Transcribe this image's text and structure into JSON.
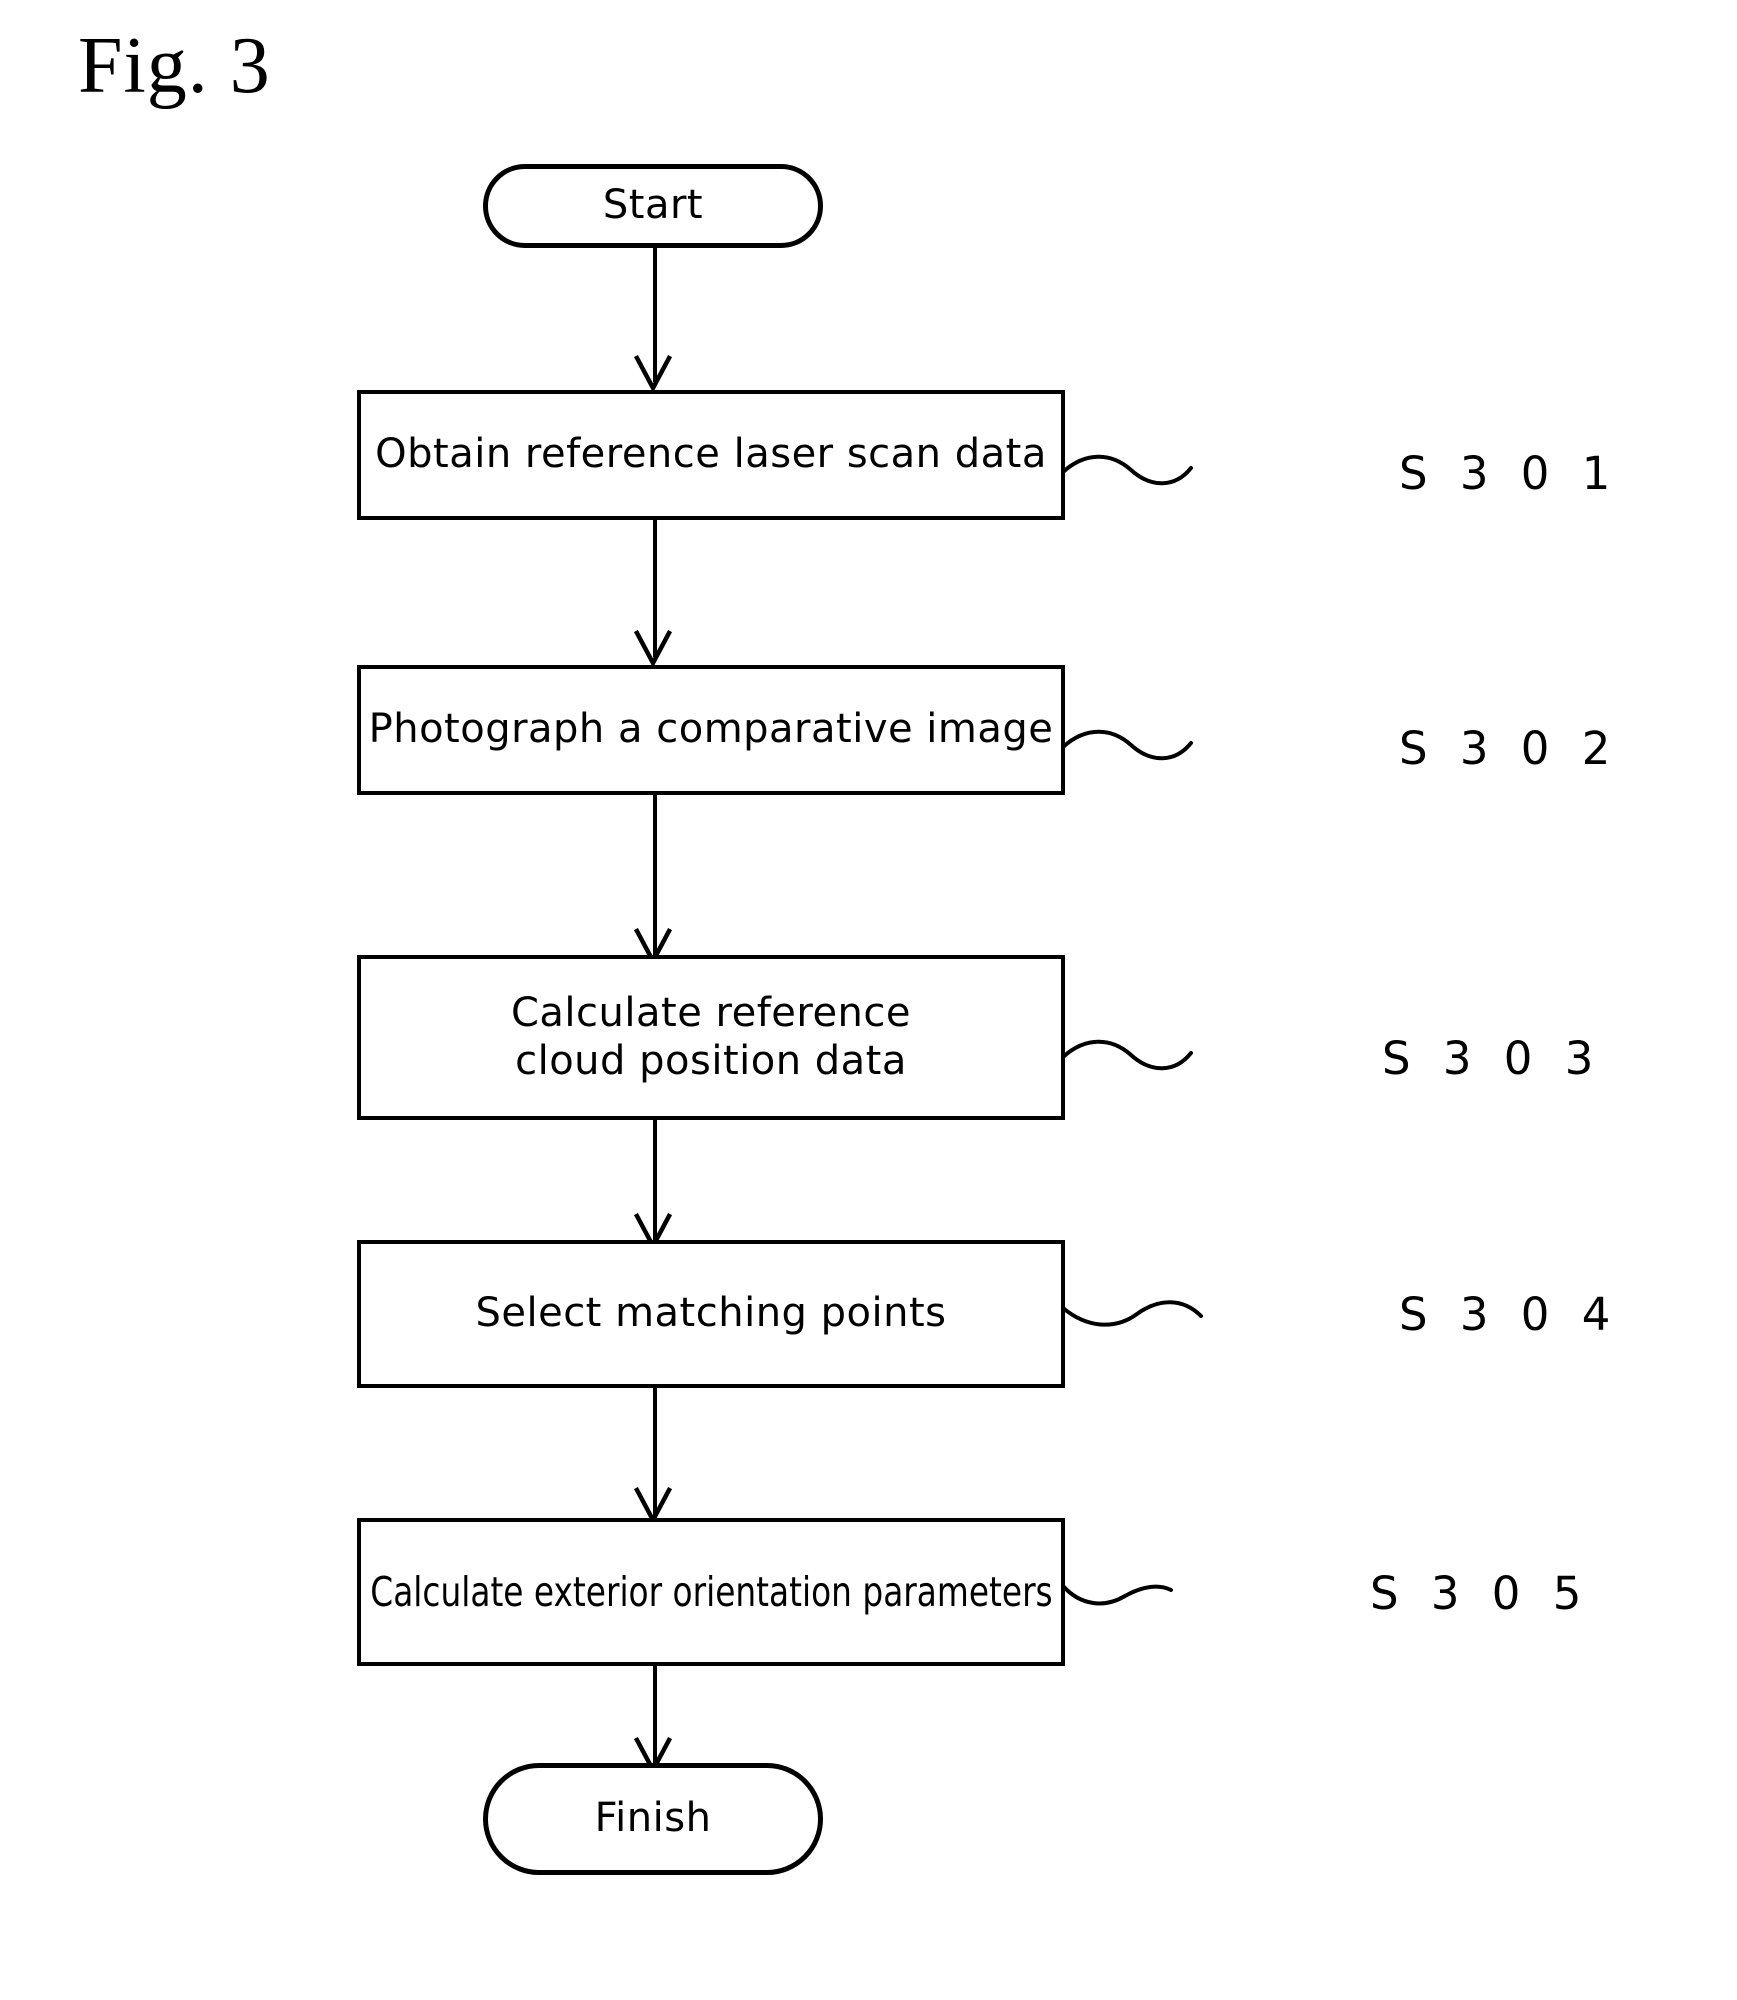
{
  "figure": {
    "title": "Fig. 3"
  },
  "flowchart": {
    "type": "process-flowchart",
    "orientation": "top-to-bottom",
    "nodes": [
      {
        "id": "start",
        "shape": "terminal",
        "label": "Start"
      },
      {
        "id": "s301",
        "shape": "process",
        "label": "Obtain reference laser scan data"
      },
      {
        "id": "s302",
        "shape": "process",
        "label": "Photograph a comparative image"
      },
      {
        "id": "s303",
        "shape": "process",
        "label": "Calculate reference\ncloud position data"
      },
      {
        "id": "s304",
        "shape": "process",
        "label": "Select matching points"
      },
      {
        "id": "s305",
        "shape": "process",
        "label": "Calculate exterior orientation parameters"
      },
      {
        "id": "finish",
        "shape": "terminal",
        "label": "Finish"
      }
    ],
    "callouts": [
      {
        "for": "s301",
        "label": "S 3 0 1"
      },
      {
        "for": "s302",
        "label": "S 3 0 2"
      },
      {
        "for": "s303",
        "label": "S 3 0 3"
      },
      {
        "for": "s304",
        "label": "S 3 0 4"
      },
      {
        "for": "s305",
        "label": "S 3 0 5"
      }
    ],
    "edges": [
      {
        "from": "start",
        "to": "s301"
      },
      {
        "from": "s301",
        "to": "s302"
      },
      {
        "from": "s302",
        "to": "s303"
      },
      {
        "from": "s303",
        "to": "s304"
      },
      {
        "from": "s304",
        "to": "s305"
      },
      {
        "from": "s305",
        "to": "finish"
      }
    ],
    "colors": {
      "stroke": "#000000",
      "fill": "#ffffff",
      "text": "#000000"
    }
  }
}
